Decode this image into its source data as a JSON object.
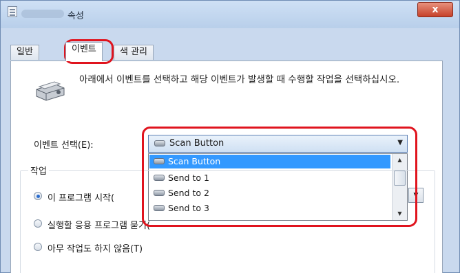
{
  "window": {
    "title": "속성",
    "close_label": "x"
  },
  "tabs": [
    {
      "label": "일반",
      "active": false
    },
    {
      "label": "이벤트",
      "active": true
    },
    {
      "label": "색 관리",
      "active": false
    }
  ],
  "description": "아래에서 이벤트를 선택하고 해당 이벤트가 발생할 때 수행할 작업을 선택하십시오.",
  "event_select": {
    "label": "이벤트 선택(E):",
    "value": "Scan Button",
    "options": [
      "Scan Button",
      "Send to 1",
      "Send to 2",
      "Send to 3"
    ],
    "selected_index": 0
  },
  "actions": {
    "group_label": "작업",
    "options": [
      {
        "label": "이 프로그램 시작(",
        "checked": true
      },
      {
        "label": "실행할 응용 프로그램 묻기(",
        "checked": false
      },
      {
        "label": "아무 작업도 하지 않음(T)",
        "checked": false
      }
    ]
  },
  "colors": {
    "highlight": "#e0141e",
    "selection": "#3399ff"
  },
  "icons": [
    "scanner-icon",
    "close-icon",
    "chevron-down-icon"
  ]
}
